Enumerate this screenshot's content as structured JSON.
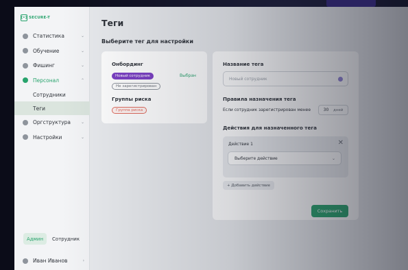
{
  "app": {
    "logo_text": "SECURE-T",
    "logo_mark": "[•]"
  },
  "sidebar": {
    "items": [
      {
        "label": "Статистика",
        "icon": "chart-icon"
      },
      {
        "label": "Обучение",
        "icon": "education-icon"
      },
      {
        "label": "Фишинг",
        "icon": "mail-icon"
      },
      {
        "label": "Персонал",
        "icon": "people-icon"
      },
      {
        "label": "Оргструктура",
        "icon": "org-icon"
      },
      {
        "label": "Настройки",
        "icon": "gear-icon"
      }
    ],
    "sub_items": [
      {
        "label": "Сотрудники"
      },
      {
        "label": "Теги"
      }
    ],
    "chevron": "⌄",
    "chevron_up": "⌃"
  },
  "roles": {
    "admin": "Админ",
    "employee": "Сотрудник"
  },
  "user": {
    "name": "Иван Иванов",
    "chevron": "›"
  },
  "main": {
    "title": "Теги",
    "subtitle": "Выберите тег для настройки"
  },
  "tags": {
    "groups": [
      {
        "title": "Онбординг",
        "chosen_label": "Выбран",
        "chips": [
          "Новый сотрудник",
          "Не зарегистрирован"
        ]
      },
      {
        "title": "Группы риска",
        "chips": [
          "Группа риска"
        ]
      }
    ]
  },
  "settings": {
    "name_label": "Название тега",
    "name_placeholder": "Новый сотрудник",
    "color": "#8f82d6",
    "rules_label": "Правила назначения тега",
    "rule_text": "Если сотрудник зарегистрирован менее",
    "days_value": "30",
    "days_unit": "дней",
    "actions_label": "Действия для назначенного тега",
    "action": {
      "title": "Действие 1",
      "close": "✕",
      "select_placeholder": "Выберите действие",
      "chevron": "⌄"
    },
    "add_action": "+ Добавить действие",
    "save": "Сохранить"
  },
  "colors": {
    "accent": "#27a36c",
    "chip_purple": "#7b3fc4",
    "chip_red": "#e06a5c"
  }
}
